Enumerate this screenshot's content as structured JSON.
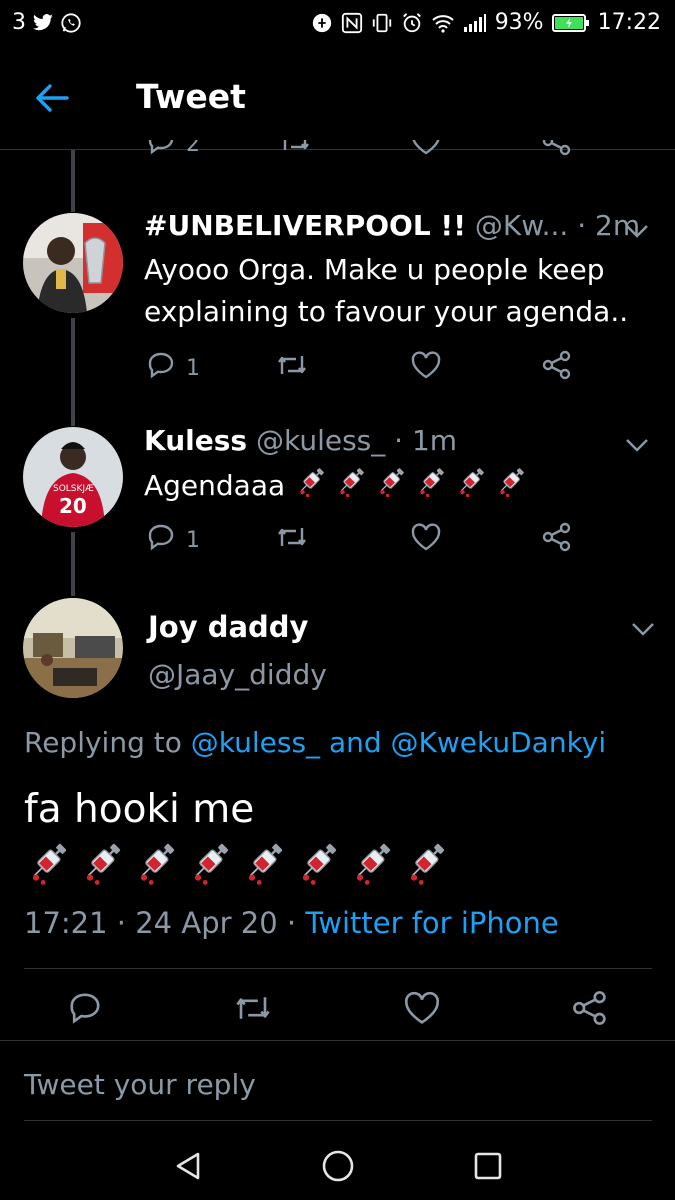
{
  "status_bar": {
    "notif_count": "3",
    "battery": "93%",
    "time": "17:22",
    "left_icons": [
      "twitter-icon",
      "whatsapp-icon"
    ],
    "right_icons": [
      "data-saver-icon",
      "nfc-icon",
      "vibrate-icon",
      "alarm-icon",
      "wifi-icon",
      "signal-icon",
      "battery-charging-icon"
    ]
  },
  "header": {
    "title": "Tweet",
    "back_icon": "back-arrow-icon"
  },
  "partial_tweet": {
    "reply_count": "2"
  },
  "tweets": [
    {
      "name": "#UNBELIVERPOOL !!",
      "handle": "@Kw...",
      "sep": " · ",
      "time": "2m",
      "text_line1": "Ayooo Orga. Make u people keep",
      "text_line2": "explaining to favour your agenda..",
      "reply_count": "1"
    },
    {
      "name": "Kuless",
      "handle": "@kuless_",
      "sep": " · ",
      "time": "1m",
      "text": "Agendaaa",
      "reply_count": "1"
    }
  ],
  "main_tweet": {
    "name": "Joy daddy",
    "handle": "@Jaay_diddy",
    "replying_prefix": "Replying to ",
    "replying_to_1": "@kuless_",
    "replying_and": " and ",
    "replying_to_2": "@KwekuDankyi",
    "text": "fa hooki me",
    "time": "17:21",
    "date_sep": " · ",
    "date": "24 Apr 20",
    "client_sep": " · ",
    "client": "Twitter for iPhone"
  },
  "reply_box": {
    "placeholder": "Tweet your reply"
  },
  "colors": {
    "link": "#1da1f2",
    "muted": "#8b98a5",
    "bg": "#000000",
    "divider": "#2f3336"
  }
}
